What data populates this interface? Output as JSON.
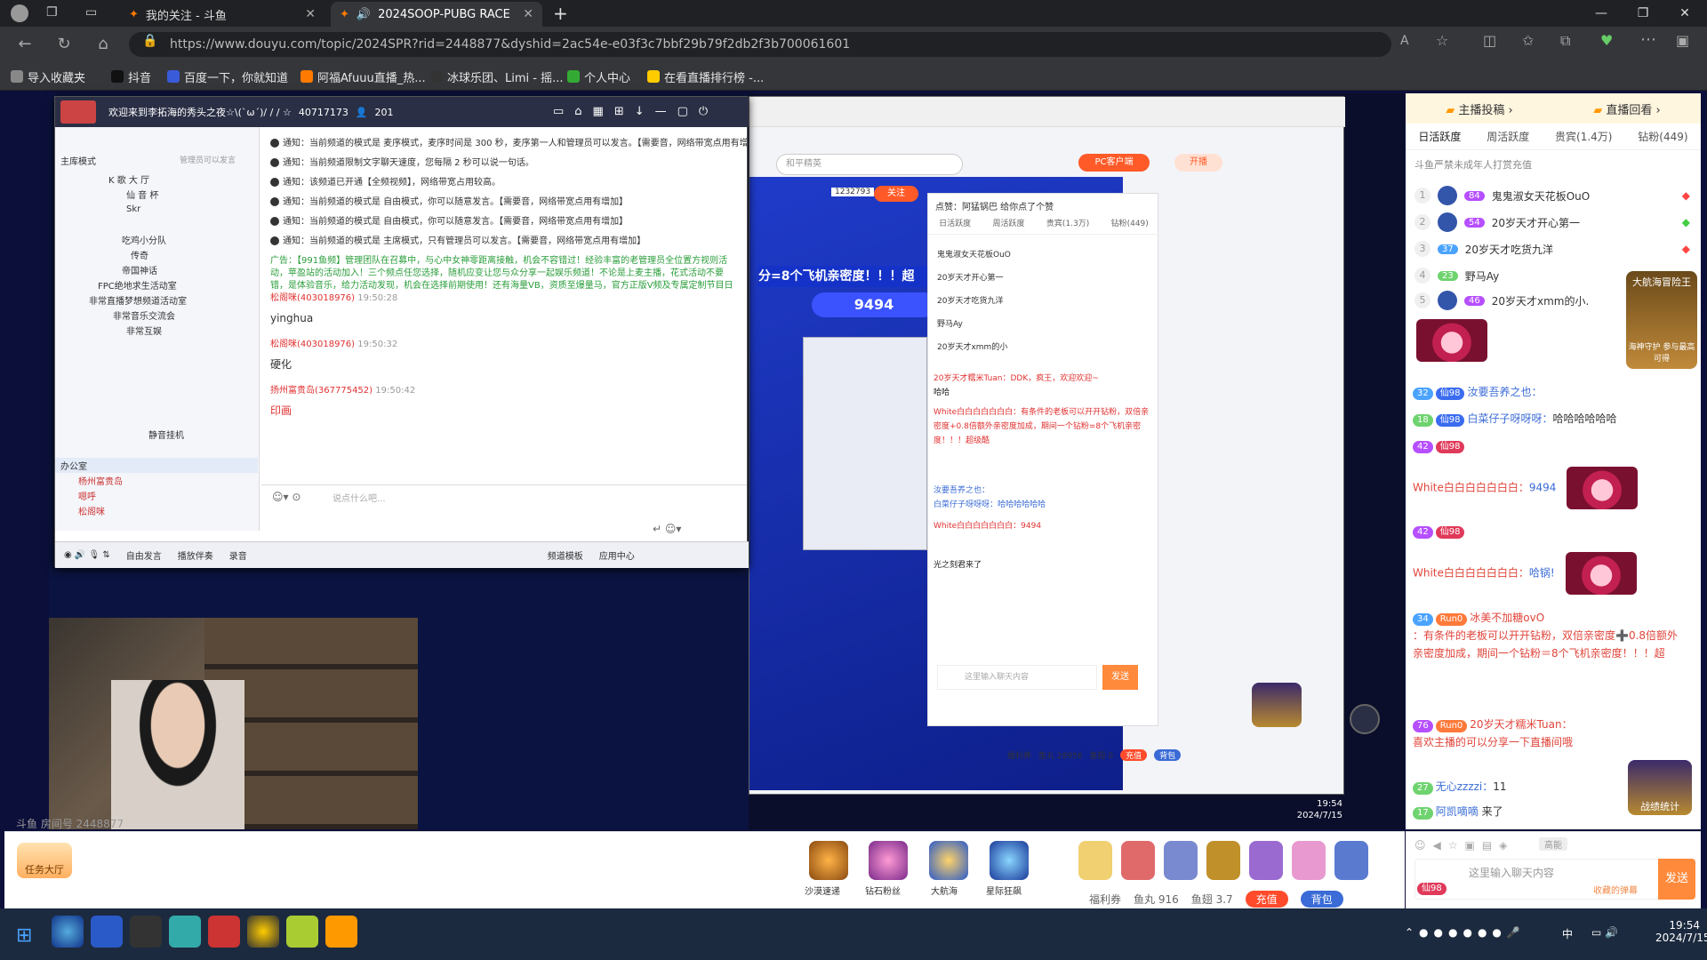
{
  "browser": {
    "tabs": [
      {
        "title": "我的关注 - 斗鱼",
        "active": false
      },
      {
        "title": "2024SOOP-PUBG RACE: S",
        "active": true
      }
    ],
    "url": "https://www.douyu.com/topic/2024SPR?rid=2448877&dyshid=2ac54e-e03f3c7bbf29b79f2db2f3b700061601",
    "bookmarks": [
      "导入收藏夹",
      "抖音",
      "百度一下，你就知道",
      "阿福Afuuu直播_热...",
      "冰球乐团、Limi - 摇...",
      "个人中心",
      "在看直播排行榜 -..."
    ]
  },
  "tool": {
    "header_title": "欢迎来到李拓海的秀头之夜☆\\(`ω´)/ / / ☆",
    "header_id": "40717173",
    "header_count": "201",
    "left_title": "主库模式",
    "left_subtitle": "管理员可以发言",
    "tree": [
      "K 歌 大 厅",
      "仙 音 杯",
      "Skr",
      "吃鸡小分队",
      "传奇",
      "帝国神话",
      "FPC绝地求生活动室",
      "非常直播梦想频道活动室",
      "非常音乐交流会",
      "非常互娱",
      "静音挂机",
      "办公室"
    ],
    "office_users": [
      "杨州富贵岛",
      "嗯呼",
      "松阁咪"
    ],
    "notices": [
      "通知：当前频道的模式是 麦序模式，麦序时间是 300 秒，麦序第一人和管理员可以发言。【需要音，网络带宽点用有增加】",
      "通知：当前频道限制文字聊天速度，您每隔 2 秒可以说一句话。",
      "通知：该频道已开通【全频视频】，网络带宽占用较高。",
      "通知：当前频道的模式是 自由模式，你可以随意发言。【需要音，网络带宽点用有增加】",
      "通知：当前频道的模式是 自由模式，你可以随意发言。【需要音，网络带宽点用有增加】",
      "通知：当前频道的模式是 主席模式，只有管理员可以发言。【需要音，网络带宽点用有增加】"
    ],
    "ad": "广告：【991鱼频】管理团队在召募中，与心中女神零距离接触，机会不容错过！经验丰富的老管理员全位置方视则活动，苹盈站的活动加入！三个频点任您选择，随机应变让您与众分享一起娱乐频道！不论是上麦主播，花式活动不要错，是体验音乐，给力活动发现，机会在选择前期使用！还有海量VB，资质至爆量马，官方正版V频及专属定制节目日礼盒等周边奖励【快快联我一起Happy吧】",
    "chats": [
      {
        "user": "松阁咪(403018976)",
        "time": "19:50:28",
        "text": "yinghua"
      },
      {
        "user": "松阁咪(403018976)",
        "time": "19:50:32",
        "text": "硬化"
      },
      {
        "user": "扬州富贵岛(367775452)",
        "time": "19:50:42",
        "text": "印画"
      }
    ],
    "input_placeholder": "说点什么吧...",
    "toolbar": [
      "自由发言",
      "播放伴奏",
      "录音",
      "频道模板",
      "应用中心"
    ]
  },
  "inner_browser": {
    "search_placeholder": "和平精英",
    "pc_button": "PC客户端",
    "start_button": "开播",
    "follow": "关注",
    "follow_count": "1232793",
    "banner_text": "分=8个飞机亲密度！！！超",
    "gem_count": "9494",
    "chat_header": "点赞：阿猛锅巴 给你点了个赞",
    "chat_tabs": [
      "日活跃度",
      "周活跃度",
      "贵宾(1.3万)",
      "钻粉(449)"
    ],
    "rank_names": [
      "鬼鬼淑女天花板OuO",
      "20岁天才开心第一",
      "20岁天才吃货九洋",
      "野马Ay",
      "20岁天才xmm的小"
    ],
    "msgs": [
      "20岁天才糯米Tuan：DDK，疯王，欢迎欢迎~",
      "哈哈",
      "White白白白白白白白：有条件的老板可以开开钻粉，双倍亲密度+0.8倍额外亲密度加成，期间一个钻粉=8个飞机亲密度！！！超级酷",
      "汝要吾养之也：",
      "白菜仔子呀呀呀：哈哈哈哈哈哈",
      "White白白白白白白白：9494",
      "光之刻君来了"
    ],
    "input_placeholder": "这里输入聊天内容",
    "send": "发送",
    "bottom": [
      "福利券",
      "鱼丸 28956",
      "鱼翅 0",
      "充值",
      "背包"
    ],
    "time": "19:54",
    "date": "2024/7/15"
  },
  "video_overlay": {
    "watermark": "斗鱼 房间号 2448877",
    "time": "19:54",
    "date": "2024/7/15"
  },
  "sidebar": {
    "top": [
      "主播投稿",
      "直播回看"
    ],
    "tabs": [
      "日活跃度",
      "周活跃度",
      "贵宾(1.4万)",
      "钻粉(449)"
    ],
    "notice": "斗鱼严禁未成年人打赏充值",
    "ranks": [
      {
        "n": "1",
        "lv": "84",
        "name": "鬼鬼淑女天花板OuO"
      },
      {
        "n": "2",
        "lv": "54",
        "name": "20岁天才开心第一"
      },
      {
        "n": "3",
        "lv": "37",
        "name": "20岁天才吃货九洋"
      },
      {
        "n": "4",
        "lv": "23",
        "name": "野马Ay"
      },
      {
        "n": "5",
        "lv": "46",
        "name": "20岁天才xmm的小..."
      }
    ],
    "side_badge_1": "大航海冒险王",
    "side_badge_2": "海神守护 参与最高可得",
    "msgs": [
      {
        "lv": "32",
        "fan": "仙98",
        "user": "汝要吾养之也：",
        "text": ""
      },
      {
        "lv": "18",
        "fan": "仙98",
        "user": "白菜仔子呀呀呀：",
        "text": "哈哈哈哈哈哈"
      },
      {
        "lv": "42",
        "fan": "仙98",
        "user": "White白白白白白白白：",
        "text": "9494"
      },
      {
        "lv": "42",
        "fan": "仙98",
        "user": "White白白白白白白白：",
        "text": "哈锅!"
      },
      {
        "lv": "34",
        "fan": "Run0",
        "user": "冰美不加糖ovO",
        "text": "：有条件的老板可以开开钻粉，双倍亲密度➕0.8倍额外亲密度加成，期间一个钻粉＝8个飞机亲密度！！！超"
      },
      {
        "lv": "76",
        "fan": "Run0",
        "user": "20岁天才糯米Tuan：",
        "text": "喜欢主播的可以分享一下直播间哦"
      },
      {
        "lv": "27",
        "fan": "",
        "user": "无心zzzzi：",
        "text": "11"
      },
      {
        "lv": "17",
        "fan": "",
        "user": "阿凯嘀嘀",
        "text": "来了"
      }
    ],
    "battle_badge": "战绩统计",
    "input_placeholder": "这里输入聊天内容",
    "input_badge": "仙98",
    "barrage": "收藏的弹幕",
    "send": "发送",
    "high": "高能"
  },
  "bottombar": {
    "task": "任务大厅",
    "gifts": [
      "沙漠速递",
      "钻石粉丝",
      "大航海",
      "星际狂飙"
    ],
    "fuli": "福利券",
    "yuwan": "鱼丸 916",
    "yuchi": "鱼翅 3.7",
    "charge": "充值",
    "bag": "背包"
  },
  "taskbar": {
    "time": "19:54",
    "date": "2024/7/15",
    "ime": "中"
  }
}
